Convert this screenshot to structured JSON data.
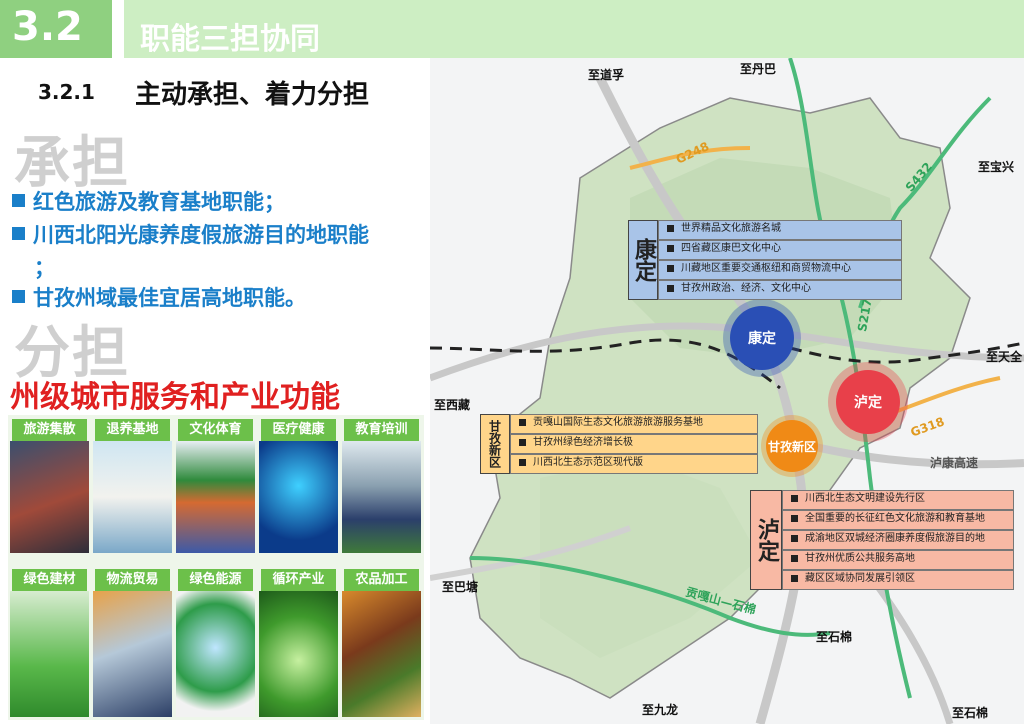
{
  "header": {
    "section_number": "3.2",
    "section_title": "职能三担协同"
  },
  "subheading": {
    "number": "3.2.1",
    "title": "主动承担、着力分担"
  },
  "chengdan": {
    "heading": "承担",
    "items": [
      "红色旅游及教育基地职能；",
      "川西北阳光康养度假旅游目的地职能",
      "；",
      "甘孜州域最佳宜居高地职能。"
    ]
  },
  "fendan": {
    "heading": "分担",
    "subtitle": "州级城市服务和产业功能"
  },
  "tiles": [
    "旅游集散",
    "退养基地",
    "文化体育",
    "医疗健康",
    "教育培训",
    "绿色建材",
    "物流贸易",
    "绿色能源",
    "循环产业",
    "农品加工"
  ],
  "map": {
    "destinations": {
      "daofu": "至道孚",
      "danba": "至丹巴",
      "baoxing": "至宝兴",
      "tianquan": "至天全",
      "xizang": "至西藏",
      "batang": "至巴塘",
      "shimian1": "至石棉",
      "jiulong": "至九龙",
      "shimian2": "至石棉"
    },
    "roads": {
      "g248": "G248",
      "s432": "S432",
      "s217": "S217",
      "g318": "G318",
      "expressway": "泸康高速",
      "gonggashan": "贡嘎山—石棉"
    },
    "nodes": {
      "kangding": "康定",
      "luding": "泸定",
      "ganzi_new": "甘孜新区"
    },
    "kangding_box": {
      "head": "康定",
      "items": [
        "世界精品文化旅游名城",
        "四省藏区康巴文化中心",
        "川藏地区重要交通枢纽和商贸物流中心",
        "甘孜州政治、经济、文化中心"
      ]
    },
    "ganzi_box": {
      "head": "甘孜新区",
      "items": [
        "贡嘎山国际生态文化旅游旅游服务基地",
        "甘孜州绿色经济增长极",
        "川西北生态示范区现代版"
      ]
    },
    "luding_box": {
      "head": "泸定",
      "items": [
        "川西北生态文明建设先行区",
        "全国重要的长征红色文化旅游和教育基地",
        "成渝地区双城经济圈康养度假旅游目的地",
        "甘孜州优质公共服务高地",
        "藏区区域协同发展引领区"
      ]
    },
    "colors": {
      "kangding_box": "#a9c4e8",
      "ganzi_box": "#ffd58a",
      "luding_box": "#f8b9a4",
      "kangding_circle": "#2a4fb5",
      "luding_circle": "#e8404a",
      "ganzi_circle": "#f08a16"
    }
  }
}
